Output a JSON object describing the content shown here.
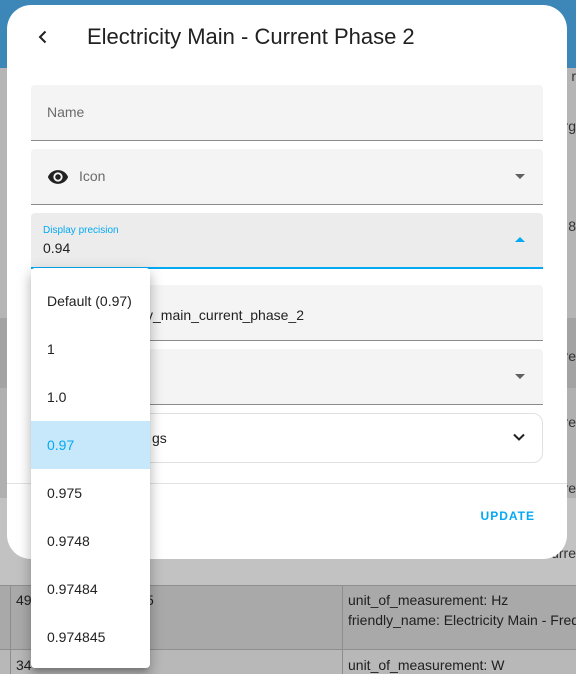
{
  "dialog": {
    "title": "Electricity Main - Current Phase 2",
    "fields": {
      "name_label": "Name",
      "icon_label": "Icon",
      "display_precision_label": "Display precision",
      "display_precision_value": "0.94",
      "entity_id_partial": "y_main_current_phase_2",
      "advanced_partial": "gs"
    },
    "update_label": "UPDATE"
  },
  "precision_menu": {
    "options": [
      "Default (0.97)",
      "1",
      "1.0",
      "0.97",
      "0.975",
      "0.9748",
      "0.97484",
      "0.974845"
    ],
    "selected": "0.97"
  },
  "background": {
    "row_a_id_partial": "49",
    "row_a_num_partial": "5",
    "row_a_attr_1": "unit_of_measurement: Hz",
    "row_a_attr_2": "friendly_name: Electricity Main - Freq",
    "row_b_id_partial": "34",
    "row_b_attr_1": "unit_of_measurement: W",
    "right_edge_texts": [
      "r",
      "rg",
      "8",
      "rre",
      "rre",
      "rre",
      "urre"
    ]
  },
  "colors": {
    "accent": "#03a9f4",
    "selected_bg": "#c6e8fa",
    "topbar": "#3d86b8"
  }
}
